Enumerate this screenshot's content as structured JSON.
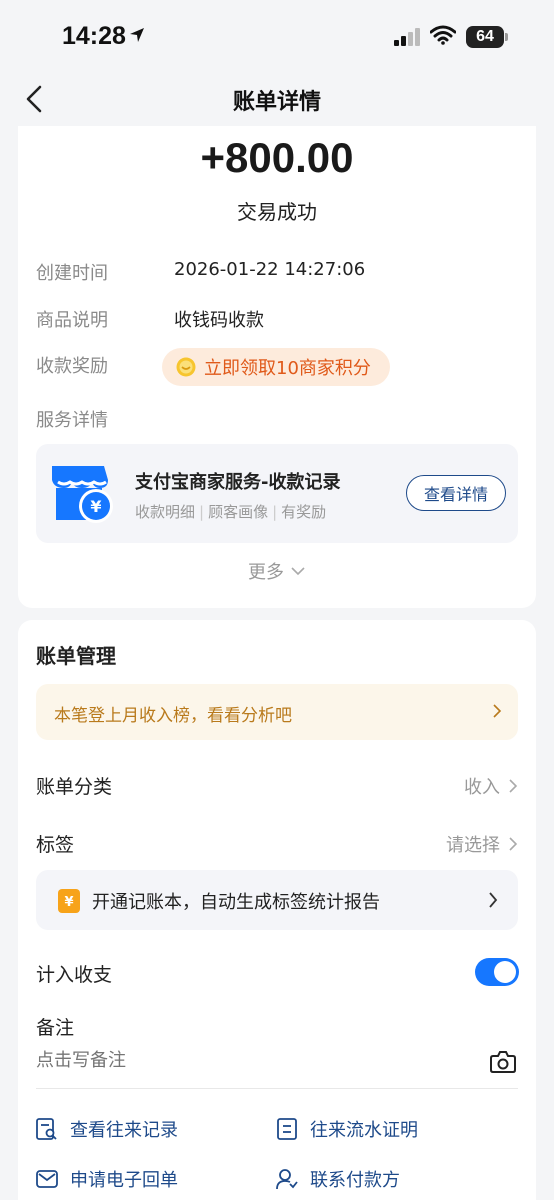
{
  "status_bar": {
    "time": "14:28",
    "battery": "64"
  },
  "nav": {
    "title": "账单详情"
  },
  "summary": {
    "amount": "+800.00",
    "status": "交易成功",
    "rows": [
      {
        "label": "创建时间",
        "value": "2026-01-22 14:27:06"
      },
      {
        "label": "商品说明",
        "value": "收钱码收款"
      }
    ],
    "reward_label": "收款奖励",
    "reward_text": "立即领取10商家积分",
    "service_label": "服务详情",
    "service": {
      "title": "支付宝商家服务-收款记录",
      "subtitle_parts": [
        "收款明细",
        "顾客画像",
        "有奖励"
      ],
      "button": "查看详情"
    },
    "more": "更多"
  },
  "management": {
    "title": "账单管理",
    "banner": "本笔登上月收入榜，看看分析吧",
    "category": {
      "label": "账单分类",
      "value": "收入"
    },
    "tag": {
      "label": "标签",
      "value": "请选择"
    },
    "promo": "开通记账本，自动生成标签统计报告",
    "include": {
      "label": "计入收支",
      "on": true
    },
    "note": {
      "label": "备注",
      "placeholder": "点击写备注"
    },
    "actions": [
      {
        "label": "查看往来记录",
        "icon": "search-record-icon"
      },
      {
        "label": "往来流水证明",
        "icon": "certificate-icon"
      },
      {
        "label": "申请电子回单",
        "icon": "mail-icon"
      },
      {
        "label": "联系付款方",
        "icon": "contact-icon"
      }
    ]
  },
  "colors": {
    "accent": "#1677ff",
    "link": "#1e4a8a",
    "reward": "#e05a1a",
    "banner_text": "#b97a1c"
  }
}
